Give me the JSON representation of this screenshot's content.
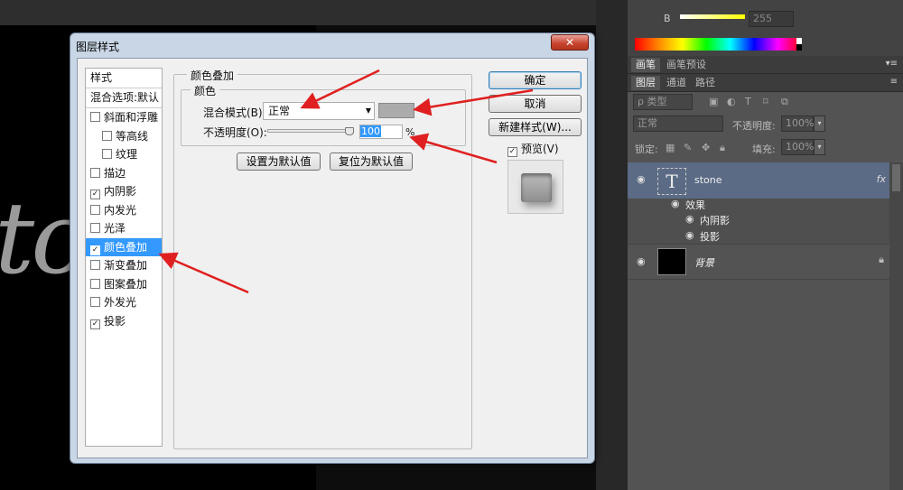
{
  "canvas": {
    "doc_text": "to"
  },
  "right_panel": {
    "color": {
      "channel_label": "B",
      "channel_value": "255",
      "accent_color": "#ffff00"
    },
    "tabs1": [
      "画笔",
      "画笔预设"
    ],
    "tabs2": [
      "图层",
      "通道",
      "路径"
    ],
    "filter": {
      "kind": "ρ 类型"
    },
    "blend_mode": "正常",
    "opacity_label": "不透明度:",
    "opacity_value": "100%",
    "lock_label": "锁定:",
    "fill_label": "填充:",
    "fill_value": "100%",
    "layers": [
      {
        "name": "stone",
        "fx": "fx",
        "thumb": "T"
      },
      {
        "name": "背景"
      }
    ],
    "effects": {
      "title": "效果",
      "items": [
        "内阴影",
        "投影"
      ]
    }
  },
  "dialog": {
    "title": "图层样式",
    "close_label": "✕",
    "style_list": {
      "header": "样式",
      "blend_options": "混合选项:默认",
      "items": [
        {
          "label": "斜面和浮雕",
          "checked": false
        },
        {
          "label": "等高线",
          "checked": false,
          "sub": true
        },
        {
          "label": "纹理",
          "checked": false,
          "sub": true
        },
        {
          "label": "描边",
          "checked": false
        },
        {
          "label": "内阴影",
          "checked": true
        },
        {
          "label": "内发光",
          "checked": false
        },
        {
          "label": "光泽",
          "checked": false
        },
        {
          "label": "颜色叠加",
          "checked": true,
          "selected": true
        },
        {
          "label": "渐变叠加",
          "checked": false
        },
        {
          "label": "图案叠加",
          "checked": false
        },
        {
          "label": "外发光",
          "checked": false
        },
        {
          "label": "投影",
          "checked": true
        }
      ]
    },
    "section_title": "颜色叠加",
    "color_group": "颜色",
    "blend_mode_label": "混合模式(B):",
    "blend_mode_value": "正常",
    "overlay_color": "#ababab",
    "opacity_label": "不透明度(O):",
    "opacity_value": "100",
    "opacity_unit": "%",
    "opacity_level": 1.0,
    "make_default": "设置为默认值",
    "reset_default": "复位为默认值",
    "ok": "确定",
    "cancel": "取消",
    "new_style": "新建样式(W)...",
    "preview": "预览(V)"
  }
}
